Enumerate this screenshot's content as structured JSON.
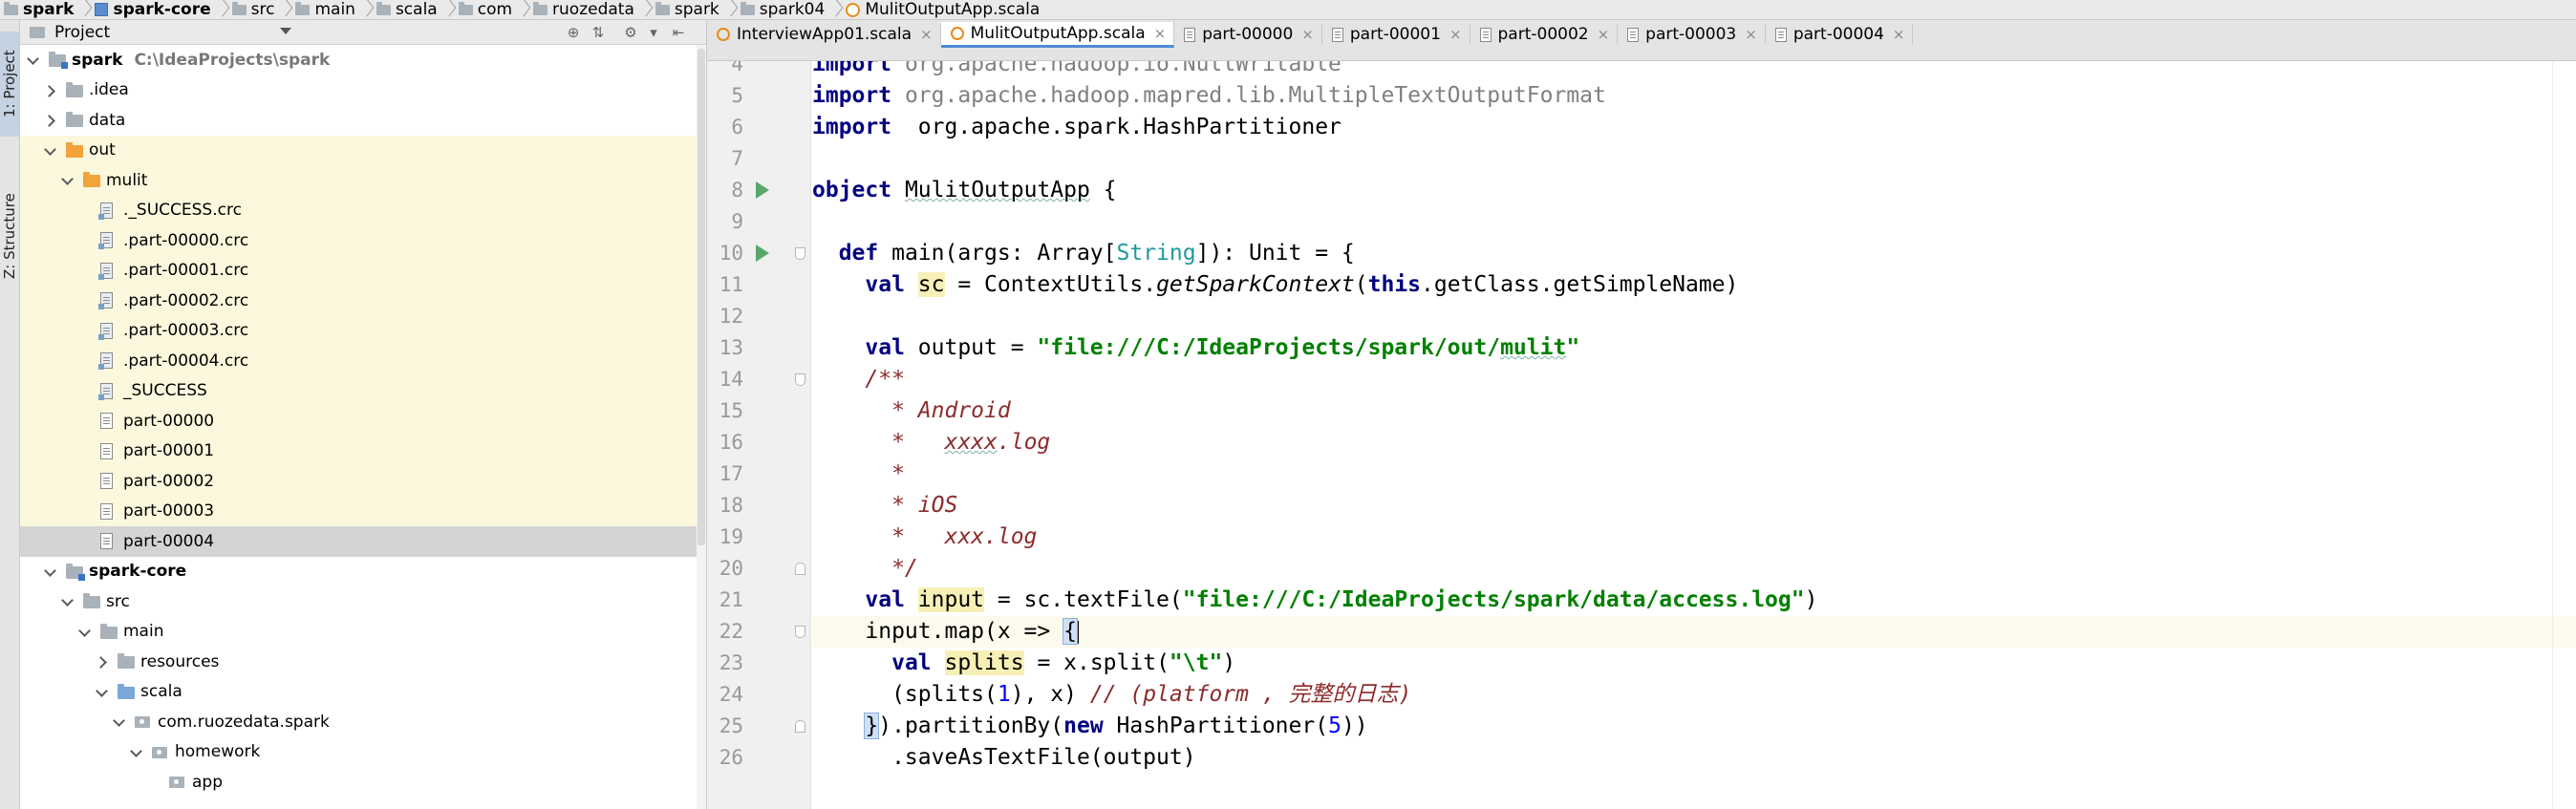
{
  "breadcrumb": [
    {
      "label": "spark",
      "icon": "folder",
      "bold": true
    },
    {
      "label": "spark-core",
      "icon": "module",
      "bold": true
    },
    {
      "label": "src",
      "icon": "folder",
      "bold": false
    },
    {
      "label": "main",
      "icon": "folder",
      "bold": false
    },
    {
      "label": "scala",
      "icon": "folder",
      "bold": false
    },
    {
      "label": "com",
      "icon": "folder",
      "bold": false
    },
    {
      "label": "ruozedata",
      "icon": "folder",
      "bold": false
    },
    {
      "label": "spark",
      "icon": "folder",
      "bold": false
    },
    {
      "label": "spark04",
      "icon": "folder",
      "bold": false
    },
    {
      "label": "MulitOutputApp.scala",
      "icon": "scala-file",
      "bold": false
    }
  ],
  "tool_strip": {
    "project_tab": "1: Project",
    "structure_tab": "Z: Structure"
  },
  "project_panel": {
    "title": "Project",
    "tree": [
      {
        "label": "spark",
        "hint": "C:\\IdeaProjects\\spark",
        "depth": 0,
        "chevron": "open",
        "icon": "module",
        "bold": true,
        "state": ""
      },
      {
        "label": ".idea",
        "depth": 1,
        "chevron": "closed",
        "icon": "folder-gray",
        "bold": false,
        "state": ""
      },
      {
        "label": "data",
        "depth": 1,
        "chevron": "closed",
        "icon": "folder-gray",
        "bold": false,
        "state": ""
      },
      {
        "label": "out",
        "depth": 1,
        "chevron": "open",
        "icon": "folder-orange",
        "bold": false,
        "state": "hl"
      },
      {
        "label": "mulit",
        "depth": 2,
        "chevron": "open",
        "icon": "folder-orange",
        "bold": false,
        "state": "hl"
      },
      {
        "label": "._SUCCESS.crc",
        "depth": 3,
        "chevron": "",
        "icon": "crc",
        "bold": false,
        "state": "hl"
      },
      {
        "label": ".part-00000.crc",
        "depth": 3,
        "chevron": "",
        "icon": "crc",
        "bold": false,
        "state": "hl"
      },
      {
        "label": ".part-00001.crc",
        "depth": 3,
        "chevron": "",
        "icon": "crc",
        "bold": false,
        "state": "hl"
      },
      {
        "label": ".part-00002.crc",
        "depth": 3,
        "chevron": "",
        "icon": "crc",
        "bold": false,
        "state": "hl"
      },
      {
        "label": ".part-00003.crc",
        "depth": 3,
        "chevron": "",
        "icon": "crc",
        "bold": false,
        "state": "hl"
      },
      {
        "label": ".part-00004.crc",
        "depth": 3,
        "chevron": "",
        "icon": "crc",
        "bold": false,
        "state": "hl"
      },
      {
        "label": "_SUCCESS",
        "depth": 3,
        "chevron": "",
        "icon": "crc",
        "bold": false,
        "state": "hl"
      },
      {
        "label": "part-00000",
        "depth": 3,
        "chevron": "",
        "icon": "doc",
        "bold": false,
        "state": "hl"
      },
      {
        "label": "part-00001",
        "depth": 3,
        "chevron": "",
        "icon": "doc",
        "bold": false,
        "state": "hl"
      },
      {
        "label": "part-00002",
        "depth": 3,
        "chevron": "",
        "icon": "doc",
        "bold": false,
        "state": "hl"
      },
      {
        "label": "part-00003",
        "depth": 3,
        "chevron": "",
        "icon": "doc",
        "bold": false,
        "state": "hl"
      },
      {
        "label": "part-00004",
        "depth": 3,
        "chevron": "",
        "icon": "doc",
        "bold": false,
        "state": "sel"
      },
      {
        "label": "spark-core",
        "depth": 1,
        "chevron": "open",
        "icon": "module",
        "bold": true,
        "state": ""
      },
      {
        "label": "src",
        "depth": 2,
        "chevron": "open",
        "icon": "folder-gray",
        "bold": false,
        "state": ""
      },
      {
        "label": "main",
        "depth": 3,
        "chevron": "open",
        "icon": "folder-gray",
        "bold": false,
        "state": ""
      },
      {
        "label": "resources",
        "depth": 4,
        "chevron": "closed",
        "icon": "folder-gray",
        "bold": false,
        "state": ""
      },
      {
        "label": "scala",
        "depth": 4,
        "chevron": "open",
        "icon": "folder-blue",
        "bold": false,
        "state": ""
      },
      {
        "label": "com.ruozedata.spark",
        "depth": 5,
        "chevron": "open",
        "icon": "package",
        "bold": false,
        "state": ""
      },
      {
        "label": "homework",
        "depth": 6,
        "chevron": "open",
        "icon": "package",
        "bold": false,
        "state": ""
      },
      {
        "label": "app",
        "depth": 7,
        "chevron": "",
        "icon": "package",
        "bold": false,
        "state": ""
      }
    ]
  },
  "tabs": [
    {
      "label": "InterviewApp01.scala",
      "icon": "scala",
      "active": false
    },
    {
      "label": "MulitOutputApp.scala",
      "icon": "scala",
      "active": true
    },
    {
      "label": "part-00000",
      "icon": "text",
      "active": false
    },
    {
      "label": "part-00001",
      "icon": "text",
      "active": false
    },
    {
      "label": "part-00002",
      "icon": "text",
      "active": false
    },
    {
      "label": "part-00003",
      "icon": "text",
      "active": false
    },
    {
      "label": "part-00004",
      "icon": "text",
      "active": false
    }
  ],
  "editor": {
    "current_line": 22,
    "lines": [
      {
        "n": 4,
        "tokens": [
          [
            "kw",
            "import"
          ],
          [
            "imp",
            " org.apache.hadoop.io.NullWritable"
          ]
        ]
      },
      {
        "n": 5,
        "tokens": [
          [
            "kw",
            "import"
          ],
          [
            "imp",
            " org.apache.hadoop.mapred.lib.MultipleTextOutputFormat"
          ]
        ]
      },
      {
        "n": 6,
        "tokens": [
          [
            "kw",
            "import"
          ],
          [
            "",
            "  org.apache.spark.HashPartitioner"
          ]
        ]
      },
      {
        "n": 7,
        "tokens": []
      },
      {
        "n": 8,
        "gutter": "run",
        "tokens": [
          [
            "kw",
            "object"
          ],
          [
            "",
            " "
          ],
          [
            "wavy",
            "MulitOutputApp"
          ],
          [
            "",
            " {"
          ]
        ]
      },
      {
        "n": 9,
        "tokens": []
      },
      {
        "n": 10,
        "gutter": "run-fold",
        "tokens": [
          [
            "",
            "  "
          ],
          [
            "kw",
            "def"
          ],
          [
            "",
            " main(args: Array["
          ],
          [
            "ty",
            "String"
          ],
          [
            "",
            "]): Unit = {"
          ]
        ]
      },
      {
        "n": 11,
        "tokens": [
          [
            "",
            "    "
          ],
          [
            "kw",
            "val"
          ],
          [
            "",
            " "
          ],
          [
            "var-hl",
            "sc"
          ],
          [
            "",
            " = ContextUtils."
          ],
          [
            "fn-it",
            "getSparkContext"
          ],
          [
            "",
            "("
          ],
          [
            "kw",
            "this"
          ],
          [
            "",
            ".getClass.getSimpleName)"
          ]
        ]
      },
      {
        "n": 12,
        "tokens": []
      },
      {
        "n": 13,
        "tokens": [
          [
            "",
            "    "
          ],
          [
            "kw",
            "val"
          ],
          [
            "",
            " output = "
          ],
          [
            "str",
            "\"file:///C:/IdeaProjects/spark/out/"
          ],
          [
            "str wavy",
            "mulit"
          ],
          [
            "str",
            "\""
          ]
        ]
      },
      {
        "n": 14,
        "gutter": "fold-down",
        "tokens": [
          [
            "doc",
            "    /**"
          ]
        ]
      },
      {
        "n": 15,
        "tokens": [
          [
            "doc",
            "      * Android"
          ]
        ]
      },
      {
        "n": 16,
        "tokens": [
          [
            "doc",
            "      *   "
          ],
          [
            "doc wavy",
            "xxxx"
          ],
          [
            "doc",
            ".log"
          ]
        ]
      },
      {
        "n": 17,
        "tokens": [
          [
            "doc",
            "      *"
          ]
        ]
      },
      {
        "n": 18,
        "tokens": [
          [
            "doc",
            "      * iOS"
          ]
        ]
      },
      {
        "n": 19,
        "tokens": [
          [
            "doc",
            "      *   xxx.log"
          ]
        ]
      },
      {
        "n": 20,
        "gutter": "fold-up",
        "tokens": [
          [
            "doc",
            "      */"
          ]
        ]
      },
      {
        "n": 21,
        "tokens": [
          [
            "",
            "    "
          ],
          [
            "kw",
            "val"
          ],
          [
            "",
            " "
          ],
          [
            "var-hl",
            "input"
          ],
          [
            "",
            " = sc.textFile("
          ],
          [
            "str",
            "\"file:///C:/IdeaProjects/spark/data/access.log\""
          ],
          [
            "",
            ")"
          ]
        ]
      },
      {
        "n": 22,
        "gutter": "fold-down",
        "tokens": [
          [
            "",
            "    input.map(x => "
          ],
          [
            "brace-hl",
            "{"
          ],
          [
            "caret",
            ""
          ]
        ]
      },
      {
        "n": 23,
        "tokens": [
          [
            "",
            "      "
          ],
          [
            "kw",
            "val"
          ],
          [
            "",
            " "
          ],
          [
            "var-hl",
            "splits"
          ],
          [
            "",
            " = x.split("
          ],
          [
            "str",
            "\"\\t\""
          ],
          [
            "",
            ")"
          ]
        ]
      },
      {
        "n": 24,
        "tokens": [
          [
            "",
            "      (splits("
          ],
          [
            "num",
            "1"
          ],
          [
            "",
            "), x) "
          ],
          [
            "cmt",
            "// (platform , 完整的日志)"
          ]
        ]
      },
      {
        "n": 25,
        "gutter": "fold-up",
        "tokens": [
          [
            "",
            "    "
          ],
          [
            "brace-hl",
            "}"
          ],
          [
            "",
            ").partitionBy("
          ],
          [
            "kw",
            "new"
          ],
          [
            "",
            " HashPartitioner("
          ],
          [
            "num",
            "5"
          ],
          [
            "",
            "))"
          ]
        ]
      },
      {
        "n": 26,
        "tokens": [
          [
            "",
            "      .saveAsTextFile(output)"
          ]
        ]
      }
    ]
  }
}
